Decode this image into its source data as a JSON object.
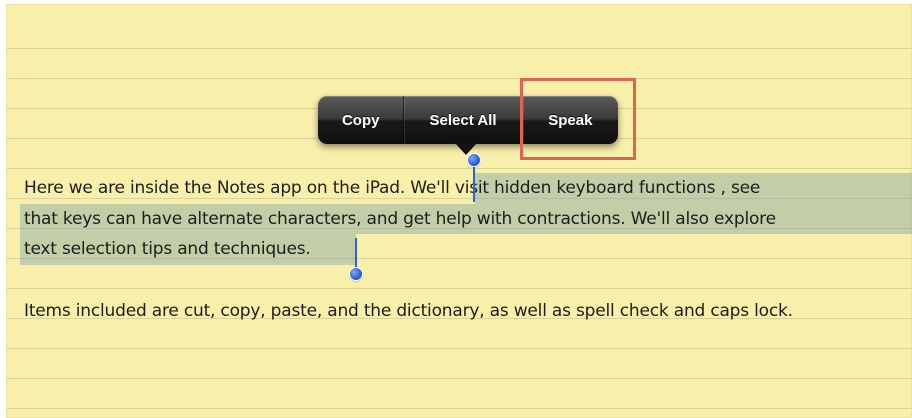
{
  "edit_menu": {
    "items": [
      {
        "label": "Copy"
      },
      {
        "label": "Select All"
      },
      {
        "label": "Speak"
      }
    ]
  },
  "note": {
    "lines": [
      "Here we are inside the Notes app on the iPad. We'll visit hidden keyboard functions , see",
      "that keys can  have alternate characters, and get help with contractions. We'll also explore",
      "text selection tips and techniques.",
      "Items included are cut, copy, paste, and the dictionary, as well as spell check and caps lock."
    ]
  },
  "colors": {
    "paper": "#f8efaa",
    "rule_line": "#d9d29a",
    "selection": "#78a0a5",
    "selection_handle": "#2a5fd6",
    "highlight_box": "#e06454",
    "menu_background": "#1a1a1a"
  },
  "icons": [
    "selection-start-handle-icon",
    "selection-end-handle-icon",
    "menu-pointer-arrow-icon"
  ]
}
